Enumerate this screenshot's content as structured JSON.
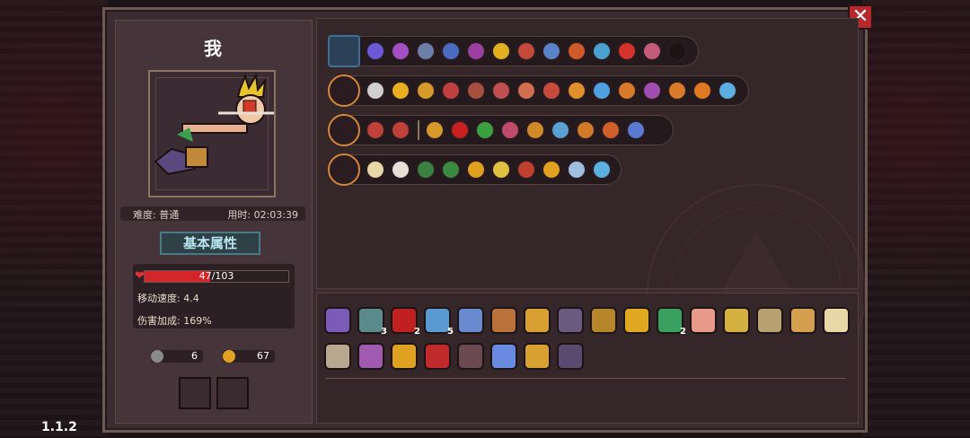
{
  "character": {
    "name": "我"
  },
  "info": {
    "difficulty": "难度: 普通",
    "time": "用时: 02:03:39"
  },
  "attributes_button": "基本属性",
  "stats": {
    "hp_text": "47/103",
    "hp_fraction": 0.456,
    "move_speed": "移动速度: 4.4",
    "damage_bonus": "伤害加成: 169%"
  },
  "currency": {
    "keys": "6",
    "coins": "67"
  },
  "version": "1.1.2",
  "close_label": "✕",
  "colors": {
    "accent_orange": "#d4863a",
    "hp_red": "#d3262b",
    "attr_button_text": "#b8e6ef"
  },
  "weapon_rows": [
    {
      "main": "treasure-chest-icon",
      "icons": [
        "#6b59d8",
        "#a44fc6",
        "#6b7fa8",
        "#4a6cc0",
        "#9b3fa0",
        "#e0b020",
        "#c34a3a",
        "#5a82c8",
        "#d05a2a",
        "#4aa0d0",
        "#d4332a",
        "#c35b7a",
        "#1a1414"
      ]
    },
    {
      "main": "spear-icon",
      "icons": [
        "#d0d0d0",
        "#e8b020",
        "#d69a2a",
        "#c04040",
        "#a85040",
        "#c05050",
        "#d07050",
        "#c84a3a",
        "#e0902a",
        "#4ea0e0",
        "#d87a2a",
        "#a04fb0",
        "#d87a2a",
        "#e07a20",
        "#5ab0e0"
      ]
    },
    {
      "main": "crimson-orb-icon",
      "icons": [
        "#c0403a",
        "#c0403a",
        "sep",
        "#d69a2a",
        "#c82020",
        "#3aa040",
        "#c04a6a",
        "#d08a2a",
        "#5aa0d0",
        "#d07a2a",
        "#d0602a",
        "#5a7ad0"
      ]
    },
    {
      "main": "blade-icon",
      "icons": [
        "#e8d8a8",
        "#e8e0d8",
        "#3a8040",
        "#3a8a40",
        "#e0a020",
        "#e0c040",
        "#c04030",
        "#e0a020",
        "#a0c0e0",
        "#5ab0e0"
      ]
    }
  ],
  "items": {
    "row1": [
      {
        "name": "witch-item",
        "color": "#7b5ab8"
      },
      {
        "name": "scroll-item",
        "color": "#5a8a8a",
        "count": "3"
      },
      {
        "name": "red-orb-item",
        "color": "#c02020",
        "count": "2"
      },
      {
        "name": "ring-item",
        "color": "#5a9ad0",
        "count": "5"
      },
      {
        "name": "crystal-item",
        "color": "#6a8ad0"
      },
      {
        "name": "boot-item",
        "color": "#b8723a"
      },
      {
        "name": "card-item",
        "color": "#d8a030"
      },
      {
        "name": "grimoire-item",
        "color": "#6a5a80"
      },
      {
        "name": "chest-item",
        "color": "#b8862a"
      },
      {
        "name": "flame-item",
        "color": "#e0a820"
      },
      {
        "name": "potion-item",
        "color": "#3aa060",
        "count": "2"
      },
      {
        "name": "mask-item",
        "color": "#e89a8a"
      },
      {
        "name": "wings-item",
        "color": "#d4b040"
      },
      {
        "name": "wand-item",
        "color": "#b8a070"
      },
      {
        "name": "urn-item",
        "color": "#d4a050"
      },
      {
        "name": "feather-item",
        "color": "#e8d8a8"
      }
    ],
    "row2": [
      {
        "name": "armor-item",
        "color": "#b8a890"
      },
      {
        "name": "staff-item",
        "color": "#a05ab0"
      },
      {
        "name": "gauntlet-item",
        "color": "#e0a020"
      },
      {
        "name": "eye-item",
        "color": "#c02a2a"
      },
      {
        "name": "pet-item",
        "color": "#6a4a50"
      },
      {
        "name": "gem-item",
        "color": "#6a8ae0"
      },
      {
        "name": "bird-item",
        "color": "#d8a030"
      },
      {
        "name": "hood-item",
        "color": "#5a4a70"
      }
    ]
  }
}
